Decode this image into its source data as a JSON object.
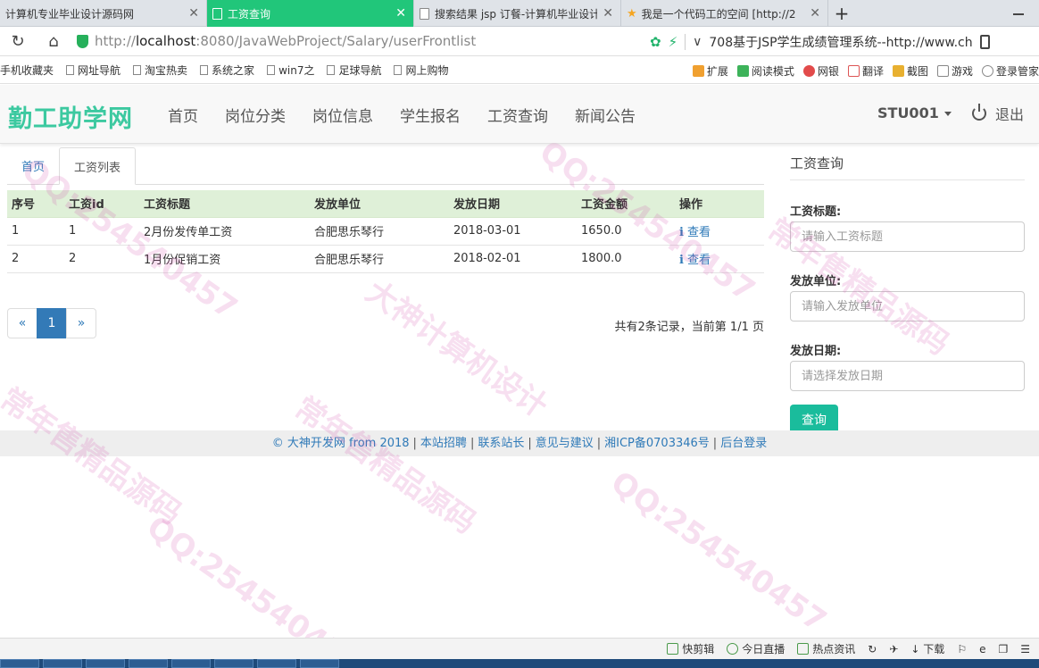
{
  "browser": {
    "tabs": [
      {
        "title": "计算机专业毕业设计源码网",
        "active": false,
        "icon": "favicon"
      },
      {
        "title": "工资查询",
        "active": true,
        "icon": "doc-icon"
      },
      {
        "title": "搜索结果 jsp 订餐-计算机毕业设计",
        "active": false,
        "icon": "doc-icon"
      },
      {
        "title": "我是一个代码工的空间 [http://2",
        "active": false,
        "icon": "star-icon"
      }
    ],
    "url_prefix": "http://",
    "url_host": "localhost",
    "url_path": ":8080/JavaWebProject/Salary/userFrontlist",
    "search_hint": "708基于JSP学生成绩管理系统--http://www.ch",
    "bookmarks": [
      "手机收藏夹",
      "网址导航",
      "淘宝热卖",
      "系统之家",
      "win7之",
      "足球导航",
      "网上购物"
    ],
    "bookmark_tools": [
      "扩展",
      "阅读模式",
      "网银",
      "翻译",
      "截图",
      "游戏",
      "登录管家"
    ],
    "status_items": [
      "快剪辑",
      "今日直播",
      "热点资讯",
      "下载"
    ]
  },
  "navbar": {
    "brand": "勤工助学网",
    "links": [
      "首页",
      "岗位分类",
      "岗位信息",
      "学生报名",
      "工资查询",
      "新闻公告"
    ],
    "user": "STU001",
    "logout": "退出"
  },
  "content": {
    "tabs": [
      {
        "label": "首页",
        "active": false
      },
      {
        "label": "工资列表",
        "active": true
      }
    ],
    "table": {
      "headers": [
        "序号",
        "工资id",
        "工资标题",
        "发放单位",
        "发放日期",
        "工资金额",
        "操作"
      ],
      "rows": [
        {
          "no": "1",
          "id": "1",
          "title": "2月份发传单工资",
          "unit": "合肥思乐琴行",
          "date": "2018-03-01",
          "amount": "1650.0",
          "action": "查看"
        },
        {
          "no": "2",
          "id": "2",
          "title": "1月份促销工资",
          "unit": "合肥思乐琴行",
          "date": "2018-02-01",
          "amount": "1800.0",
          "action": "查看"
        }
      ]
    },
    "pager": {
      "prev": "«",
      "current": "1",
      "next": "»"
    },
    "pager_info": "共有2条记录，当前第 1/1 页"
  },
  "sidebar": {
    "title": "工资查询",
    "fields": [
      {
        "label": "工资标题:",
        "placeholder": "请输入工资标题",
        "value": ""
      },
      {
        "label": "发放单位:",
        "placeholder": "请输入发放单位",
        "value": ""
      },
      {
        "label": "发放日期:",
        "placeholder": "请选择发放日期",
        "value": ""
      }
    ],
    "submit": "查询"
  },
  "footer": {
    "links": [
      "© 大神开发网 from 2018",
      "本站招聘",
      "联系站长",
      "意见与建议",
      "湘ICP备0703346号",
      "后台登录"
    ],
    "separator": "|"
  },
  "watermarks": [
    "大神计算机设计",
    "QQ:254540457",
    "常年售精品源码"
  ],
  "colors": {
    "accent": "#21c67a",
    "brand": "#3cc9a0",
    "link": "#2f7ab8",
    "table_header": "#dff0d8",
    "button": "#1abc9c",
    "pager_active": "#337ab7"
  }
}
